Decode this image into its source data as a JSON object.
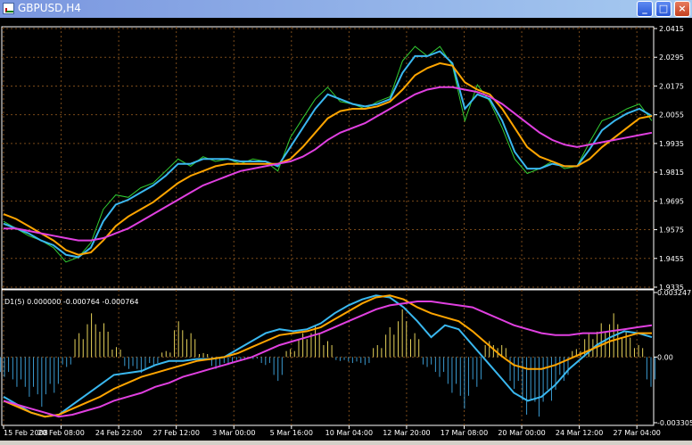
{
  "window": {
    "title": "GBPUSD,H4",
    "minimize": "_",
    "maximize": "□",
    "close": "×"
  },
  "colors": {
    "background": "#000000",
    "grid": "#7a4a1a",
    "price": "#32cd32",
    "fast": "#3ab8f0",
    "medium": "#ffa500",
    "slow": "#e040e0",
    "hist_pos": "#e6d25a",
    "hist_neg": "#3a9ad0"
  },
  "chart_data": [
    {
      "type": "line",
      "title": "GBPUSD,H4",
      "y_ticks": [
        "2.0415",
        "2.0295",
        "2.0175",
        "2.0055",
        "1.9935",
        "1.9815",
        "1.9695",
        "1.9575",
        "1.9455",
        "1.9335"
      ],
      "ylim": [
        1.9335,
        2.0415
      ],
      "x_ticks": [
        "15 Feb 2008",
        "20 Feb 08:00",
        "24 Feb 22:00",
        "27 Feb 12:00",
        "3 Mar 00:00",
        "5 Mar 16:00",
        "10 Mar 04:00",
        "12 Mar 20:00",
        "17 Mar 08:00",
        "20 Mar 00:00",
        "24 Mar 12:00",
        "27 Mar 04:00"
      ],
      "series": [
        {
          "color": "price",
          "values": [
            1.961,
            1.958,
            1.955,
            1.953,
            1.95,
            1.944,
            1.946,
            1.952,
            1.966,
            1.972,
            1.971,
            1.975,
            1.977,
            1.982,
            1.987,
            1.984,
            1.988,
            1.986,
            1.987,
            1.985,
            1.987,
            1.986,
            1.982,
            1.996,
            2.004,
            2.012,
            2.017,
            2.011,
            2.01,
            2.008,
            2.011,
            2.013,
            2.028,
            2.034,
            2.03,
            2.034,
            2.026,
            2.003,
            2.018,
            2.011,
            2.0,
            1.987,
            1.981,
            1.983,
            1.986,
            1.983,
            1.984,
            1.994,
            2.003,
            2.005,
            2.008,
            2.01,
            2.003
          ]
        },
        {
          "color": "fast",
          "values": [
            1.96,
            1.958,
            1.956,
            1.953,
            1.951,
            1.947,
            1.946,
            1.95,
            1.961,
            1.968,
            1.97,
            1.973,
            1.976,
            1.98,
            1.985,
            1.985,
            1.987,
            1.987,
            1.987,
            1.986,
            1.986,
            1.986,
            1.984,
            1.992,
            2.0,
            2.008,
            2.014,
            2.012,
            2.01,
            2.009,
            2.01,
            2.012,
            2.023,
            2.03,
            2.03,
            2.032,
            2.027,
            2.008,
            2.014,
            2.012,
            2.003,
            1.99,
            1.983,
            1.983,
            1.985,
            1.984,
            1.984,
            1.991,
            1.999,
            2.003,
            2.006,
            2.008,
            2.005
          ]
        },
        {
          "color": "medium",
          "values": [
            1.964,
            1.962,
            1.959,
            1.956,
            1.953,
            1.949,
            1.947,
            1.948,
            1.953,
            1.959,
            1.963,
            1.966,
            1.969,
            1.973,
            1.977,
            1.98,
            1.982,
            1.984,
            1.985,
            1.985,
            1.985,
            1.985,
            1.985,
            1.987,
            1.992,
            1.998,
            2.004,
            2.007,
            2.008,
            2.008,
            2.009,
            2.011,
            2.016,
            2.022,
            2.025,
            2.027,
            2.026,
            2.019,
            2.016,
            2.014,
            2.008,
            2.0,
            1.992,
            1.988,
            1.986,
            1.984,
            1.984,
            1.987,
            1.992,
            1.996,
            2.0,
            2.004,
            2.005
          ]
        },
        {
          "color": "slow",
          "values": [
            1.958,
            1.958,
            1.957,
            1.956,
            1.955,
            1.954,
            1.953,
            1.953,
            1.954,
            1.956,
            1.958,
            1.961,
            1.964,
            1.967,
            1.97,
            1.973,
            1.976,
            1.978,
            1.98,
            1.982,
            1.983,
            1.984,
            1.985,
            1.986,
            1.988,
            1.991,
            1.995,
            1.998,
            2.0,
            2.002,
            2.005,
            2.008,
            2.011,
            2.014,
            2.016,
            2.017,
            2.017,
            2.016,
            2.015,
            2.013,
            2.01,
            2.006,
            2.002,
            1.998,
            1.995,
            1.993,
            1.992,
            1.993,
            1.994,
            1.995,
            1.996,
            1.997,
            1.998
          ]
        }
      ]
    },
    {
      "type": "bar",
      "title": "D1(5) 0.000000 -0.000764 -0.000764",
      "y_ticks": [
        "0.003247",
        "0.00",
        "-0.003305"
      ],
      "ylim": [
        -0.003305,
        0.003247
      ],
      "histogram": [
        -0.001,
        -0.0015,
        -0.002,
        -0.0025,
        -0.0018,
        -0.0005,
        0.0012,
        0.0022,
        0.0017,
        0.0005,
        -0.0006,
        -0.0008,
        -0.0004,
        0.0003,
        0.0018,
        0.0012,
        0.0002,
        -0.0006,
        -0.0004,
        -0.0002,
        -0.0001,
        -0.0004,
        -0.0012,
        0.0004,
        0.0012,
        0.0016,
        0.0008,
        -0.0002,
        -0.0003,
        -0.0004,
        0.0006,
        0.0015,
        0.0024,
        0.0012,
        -0.0005,
        -0.001,
        -0.0018,
        -0.0026,
        -0.0015,
        0.0008,
        0.0006,
        -0.0016,
        -0.0029,
        -0.003,
        -0.0022,
        -0.0012,
        0.0004,
        0.0012,
        0.0017,
        0.0022,
        0.0013,
        0.0006,
        -0.0015
      ],
      "series": [
        {
          "color": "fast",
          "values": [
            -0.002,
            -0.0024,
            -0.0028,
            -0.003,
            -0.0029,
            -0.0024,
            -0.0019,
            -0.0014,
            -0.0009,
            -0.0008,
            -0.0007,
            -0.0004,
            -0.0002,
            -0.0002,
            -0.0001,
            -0.0001,
            0.0,
            0.0004,
            0.0008,
            0.0012,
            0.0014,
            0.0013,
            0.0014,
            0.0017,
            0.0022,
            0.0026,
            0.0029,
            0.0031,
            0.003,
            0.0025,
            0.0018,
            0.001,
            0.0016,
            0.0014,
            0.0006,
            -0.0002,
            -0.001,
            -0.0018,
            -0.0022,
            -0.002,
            -0.0014,
            -0.0006,
            0.0,
            0.0006,
            0.001,
            0.0013,
            0.0012,
            0.001
          ]
        },
        {
          "color": "medium",
          "values": [
            -0.0022,
            -0.0025,
            -0.0028,
            -0.003,
            -0.0029,
            -0.0026,
            -0.0023,
            -0.002,
            -0.0016,
            -0.0013,
            -0.001,
            -0.0008,
            -0.0006,
            -0.0004,
            -0.0002,
            -0.0001,
            0.0,
            0.0002,
            0.0005,
            0.0008,
            0.0011,
            0.0012,
            0.0013,
            0.0015,
            0.0019,
            0.0023,
            0.0027,
            0.003,
            0.0031,
            0.0029,
            0.0025,
            0.0022,
            0.002,
            0.0018,
            0.0013,
            0.0007,
            0.0001,
            -0.0004,
            -0.0006,
            -0.0006,
            -0.0004,
            -0.0001,
            0.0002,
            0.0005,
            0.0008,
            0.001,
            0.0012,
            0.0012
          ]
        },
        {
          "color": "slow",
          "values": [
            -0.0022,
            -0.0024,
            -0.0026,
            -0.0028,
            -0.003,
            -0.0029,
            -0.0027,
            -0.0025,
            -0.0022,
            -0.002,
            -0.0018,
            -0.0015,
            -0.0013,
            -0.001,
            -0.0008,
            -0.0006,
            -0.0004,
            -0.0002,
            0.0,
            0.0003,
            0.0006,
            0.0008,
            0.001,
            0.0012,
            0.0015,
            0.0018,
            0.0021,
            0.0024,
            0.0026,
            0.0027,
            0.0028,
            0.0028,
            0.0027,
            0.0026,
            0.0025,
            0.0022,
            0.0019,
            0.0016,
            0.0014,
            0.0012,
            0.0011,
            0.0011,
            0.0012,
            0.0012,
            0.0013,
            0.0014,
            0.0015,
            0.0016
          ]
        }
      ]
    }
  ]
}
